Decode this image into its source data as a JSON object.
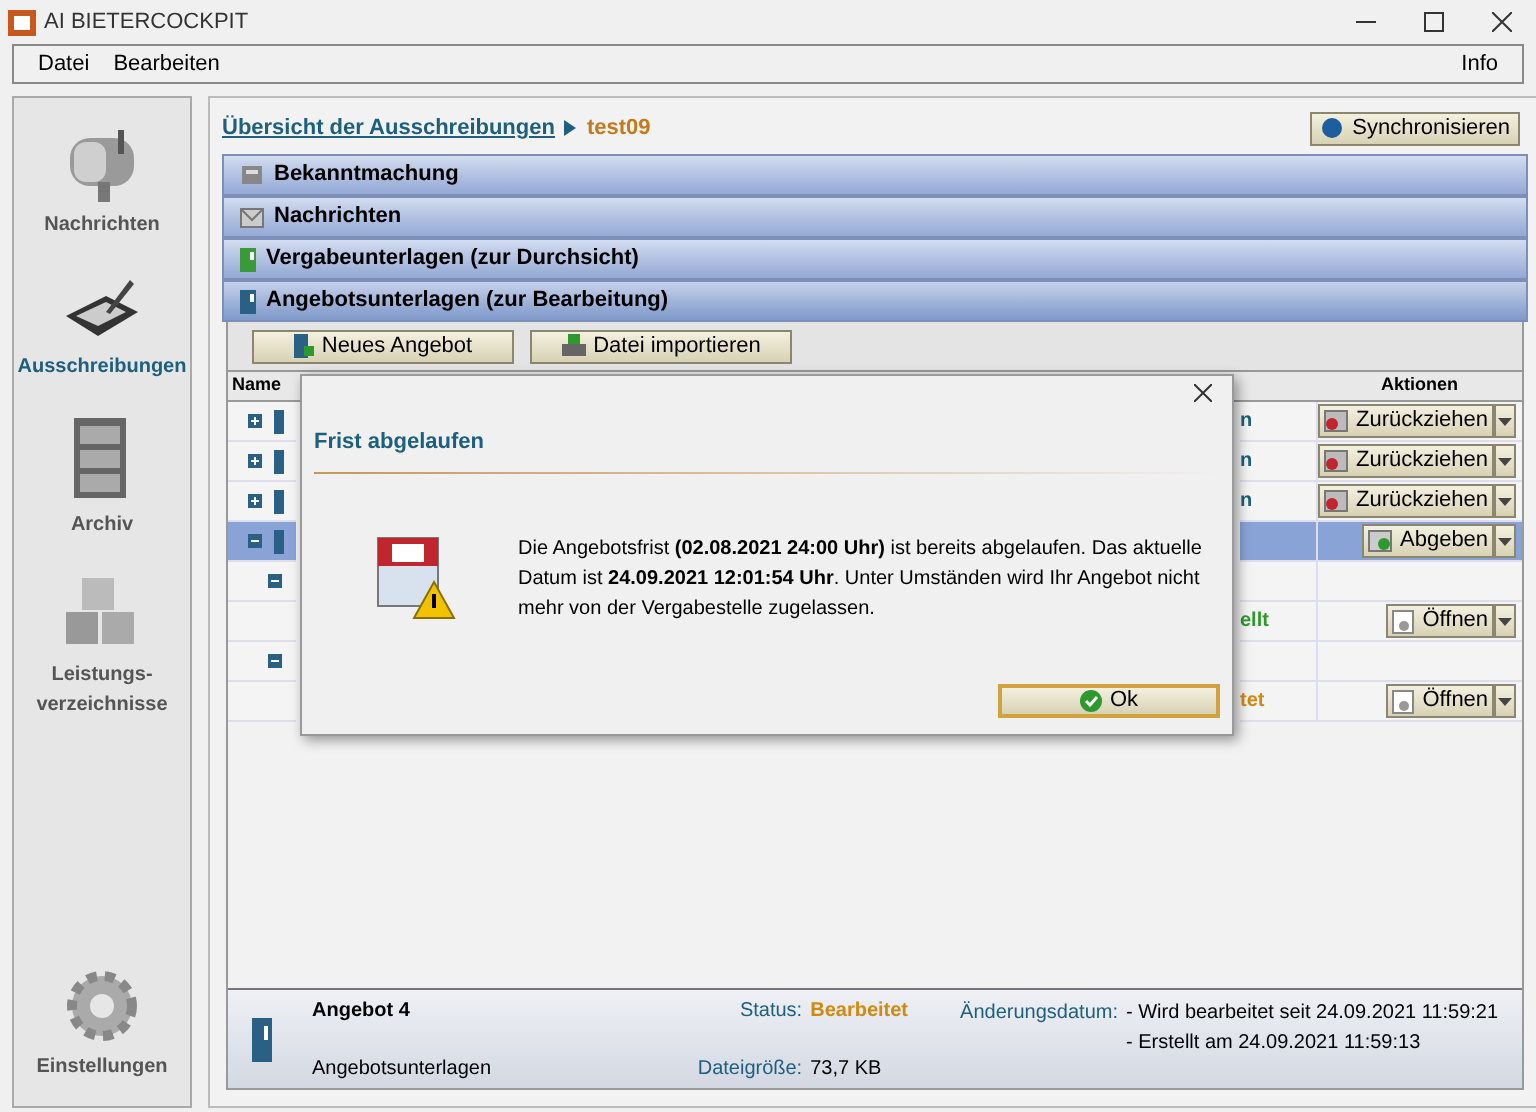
{
  "window": {
    "title": "AI BIETERCOCKPIT"
  },
  "menu": [
    "Datei",
    "Bearbeiten"
  ],
  "menu_right": "Info",
  "sidebar": {
    "items": [
      {
        "label": "Nachrichten",
        "kind": "mailbox",
        "selected": false
      },
      {
        "label": "Ausschreibungen",
        "kind": "tablet",
        "selected": true
      },
      {
        "label": "Archiv",
        "kind": "cabinet",
        "selected": false
      },
      {
        "label": "Leistungs-verzeichnisse",
        "kind": "blocks",
        "selected": false
      }
    ],
    "bottom": {
      "label": "Einstellungen"
    }
  },
  "breadcrumb": {
    "link": "Übersicht der Ausschreibungen",
    "current": "test09"
  },
  "sync_button": "Synchronisieren",
  "sections": [
    {
      "label": "Bekanntmachung",
      "kind": "notice",
      "expanded": false
    },
    {
      "label": "Nachrichten",
      "kind": "mail",
      "expanded": false
    },
    {
      "label": "Vergabeunterlagen (zur Durchsicht)",
      "kind": "green-binder",
      "expanded": false
    },
    {
      "label": "Angebotsunterlagen (zur Bearbeitung)",
      "kind": "blue-binder",
      "expanded": true
    }
  ],
  "toolbar": [
    "Neues Angebot",
    "Datei importieren"
  ],
  "table": {
    "columns": [
      "Name",
      "Aktionen"
    ],
    "rows": [
      {
        "expanded": false,
        "selected": false,
        "status": "n",
        "color": "#1d5f7e",
        "action": "Zurückziehen",
        "kind": "withdraw"
      },
      {
        "expanded": false,
        "selected": false,
        "status": "n",
        "color": "#1d5f7e",
        "action": "Zurückziehen",
        "kind": "withdraw"
      },
      {
        "expanded": false,
        "selected": false,
        "status": "n",
        "color": "#1d5f7e",
        "action": "Zurückziehen",
        "kind": "withdraw"
      },
      {
        "expanded": true,
        "selected": true,
        "action": "Abgeben",
        "kind": "submit",
        "children": [
          {
            "expanded": true,
            "selected": false,
            "children": [
              {
                "selected": false,
                "status": "ellt",
                "color": "#2e9a2e",
                "action": "Öffnen",
                "kind": "open"
              }
            ]
          },
          {
            "expanded": true,
            "selected": false,
            "children": [
              {
                "selected": false,
                "status": "tet",
                "color": "#d08a10",
                "action": "Öffnen",
                "kind": "open"
              }
            ]
          }
        ]
      }
    ]
  },
  "details": {
    "name": "Angebot 4",
    "type": "Angebotsunterlagen",
    "status_label": "Status:",
    "status": "Bearbeitet",
    "size_label": "Dateigröße:",
    "size": "73,7 KB",
    "date_label": "Änderungsdatum:",
    "dates": [
      "- Wird bearbeitet seit 24.09.2021 11:59:21",
      "- Erstellt am 24.09.2021 11:59:13"
    ]
  },
  "dialog": {
    "title": "Frist abgelaufen",
    "message": "Die Angebotsfrist **(02.08.2021 24:00 Uhr)** ist bereits abgelaufen. Das aktuelle Datum ist **24.09.2021 12:01:54 Uhr**. Unter Umständen wird Ihr Angebot nicht mehr von der Vergabestelle zugelassen.",
    "button": "Ok"
  }
}
